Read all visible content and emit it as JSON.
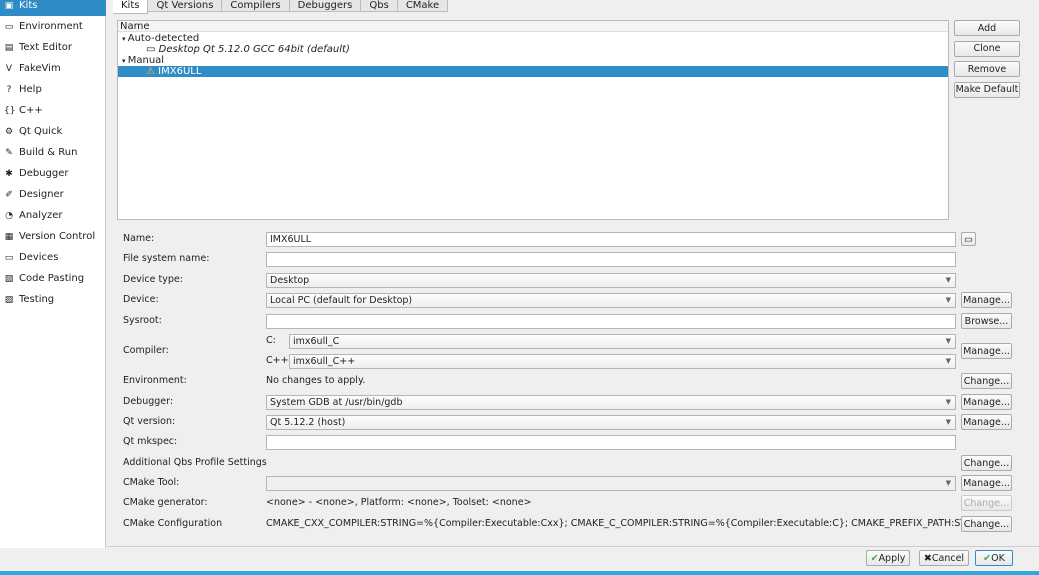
{
  "sidebar": {
    "items": [
      {
        "label": "Kits",
        "icon": "kits-icon",
        "glyph": "▣"
      },
      {
        "label": "Environment",
        "icon": "monitor-icon",
        "glyph": "▭"
      },
      {
        "label": "Text Editor",
        "icon": "text-editor-icon",
        "glyph": "▤"
      },
      {
        "label": "FakeVim",
        "icon": "fakevim-icon",
        "glyph": "V"
      },
      {
        "label": "Help",
        "icon": "help-icon",
        "glyph": "?"
      },
      {
        "label": "C++",
        "icon": "cpp-icon",
        "glyph": "{}"
      },
      {
        "label": "Qt Quick",
        "icon": "qt-quick-icon",
        "glyph": "⚙"
      },
      {
        "label": "Build & Run",
        "icon": "hammer-icon",
        "glyph": "✎"
      },
      {
        "label": "Debugger",
        "icon": "bug-icon",
        "glyph": "✱"
      },
      {
        "label": "Designer",
        "icon": "designer-icon",
        "glyph": "✐"
      },
      {
        "label": "Analyzer",
        "icon": "analyzer-icon",
        "glyph": "◔"
      },
      {
        "label": "Version Control",
        "icon": "version-control-icon",
        "glyph": "▦"
      },
      {
        "label": "Devices",
        "icon": "devices-icon",
        "glyph": "▭"
      },
      {
        "label": "Code Pasting",
        "icon": "code-pasting-icon",
        "glyph": "▧"
      },
      {
        "label": "Testing",
        "icon": "testing-icon",
        "glyph": "▨"
      }
    ]
  },
  "tabs": [
    "Kits",
    "Qt Versions",
    "Compilers",
    "Debuggers",
    "Qbs",
    "CMake"
  ],
  "tree": {
    "header": "Name",
    "auto": "Auto-detected",
    "desktop_kit": "Desktop Qt 5.12.0 GCC 64bit (default)",
    "manual": "Manual",
    "manual_kit": "IMX6ULL"
  },
  "kit_buttons": [
    "Add",
    "Clone",
    "Remove",
    "Make Default"
  ],
  "form": {
    "name": {
      "label": "Name:",
      "value": "IMX6ULL"
    },
    "fs_name": {
      "label": "File system name:",
      "value": ""
    },
    "device_type": {
      "label": "Device type:",
      "value": "Desktop"
    },
    "device": {
      "label": "Device:",
      "value": "Local PC (default for Desktop)",
      "button": "Manage..."
    },
    "sysroot": {
      "label": "Sysroot:",
      "value": "",
      "button": "Browse..."
    },
    "compiler": {
      "label": "Compiler:",
      "c_label": "C:",
      "c_value": "imx6ull_C",
      "cpp_label": "C++:",
      "cpp_value": "imx6ull_C++",
      "button": "Manage..."
    },
    "environment": {
      "label": "Environment:",
      "value": "No changes to apply.",
      "button": "Change..."
    },
    "debugger": {
      "label": "Debugger:",
      "value": "System GDB at /usr/bin/gdb",
      "button": "Manage..."
    },
    "qt_version": {
      "label": "Qt version:",
      "value": "Qt 5.12.2 (host)",
      "button": "Manage..."
    },
    "qt_mkspec": {
      "label": "Qt mkspec:",
      "value": ""
    },
    "qbs": {
      "label": "Additional Qbs Profile Settings",
      "button": "Change..."
    },
    "cmake_tool": {
      "label": "CMake Tool:",
      "value": "",
      "button": "Manage..."
    },
    "cmake_gen": {
      "label": "CMake generator:",
      "value": "<none> - <none>, Platform: <none>, Toolset: <none>",
      "button": "Change..."
    },
    "cmake_conf": {
      "label": "CMake Configuration",
      "value": "CMAKE_CXX_COMPILER:STRING=%{Compiler:Executable:Cxx}; CMAKE_C_COMPILER:STRING=%{Compiler:Executable:C}; CMAKE_PREFIX_PATH:STRING=...",
      "button": "Change..."
    }
  },
  "footer": {
    "apply": "Apply",
    "cancel": "Cancel",
    "ok": "OK"
  },
  "colors": {
    "accent": "#308cc6"
  }
}
